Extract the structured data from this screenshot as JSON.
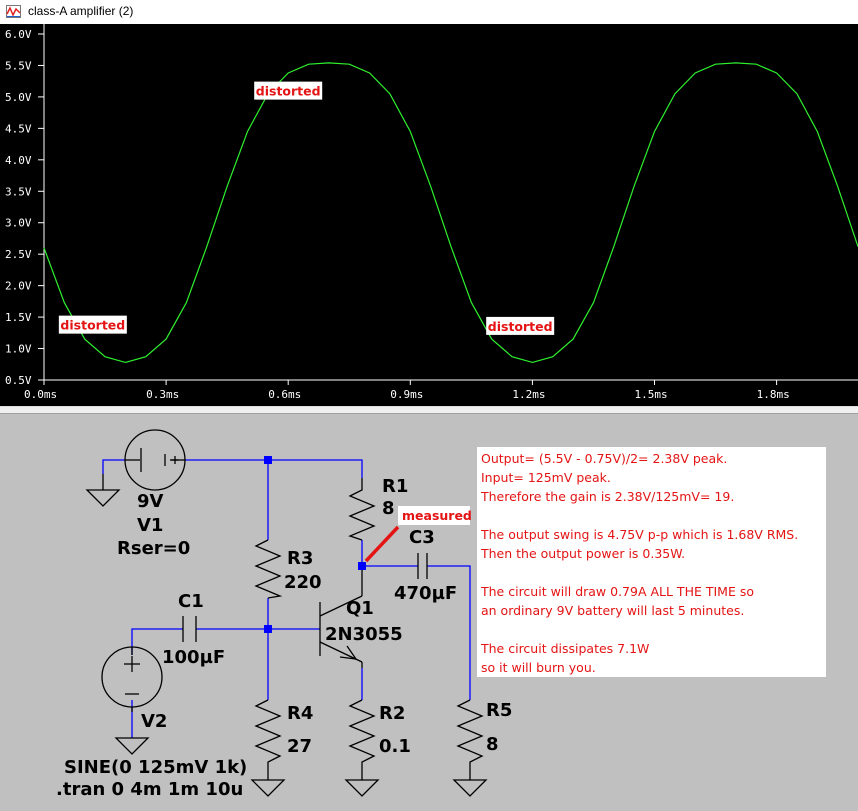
{
  "window": {
    "title": "class-A amplifier (2)",
    "icon": "waveform-icon"
  },
  "plot": {
    "background": "#000000",
    "trace_color": "#2ef02e",
    "y_ticks": [
      "6.0V",
      "5.5V",
      "5.0V",
      "4.5V",
      "4.0V",
      "3.5V",
      "3.0V",
      "2.5V",
      "2.0V",
      "1.5V",
      "1.0V",
      "0.5V"
    ],
    "x_ticks": [
      "0.0ms",
      "0.3ms",
      "0.6ms",
      "0.9ms",
      "1.2ms",
      "1.5ms",
      "1.8ms"
    ],
    "annotations": [
      "distorted",
      "distorted",
      "distorted"
    ]
  },
  "chart_data": {
    "type": "line",
    "title": "",
    "xlabel": "",
    "ylabel": "",
    "xlim": [
      0,
      2.0
    ],
    "ylim": [
      0.5,
      6.0
    ],
    "x_unit": "ms",
    "y_unit": "V",
    "grid": false,
    "series": [
      {
        "color": "#2ef02e",
        "x": [
          0.0,
          0.05,
          0.1,
          0.15,
          0.2,
          0.25,
          0.3,
          0.35,
          0.4,
          0.45,
          0.5,
          0.55,
          0.6,
          0.65,
          0.7,
          0.75,
          0.8,
          0.85,
          0.9,
          0.95,
          1.0,
          1.05,
          1.1,
          1.15,
          1.2,
          1.25,
          1.3,
          1.35,
          1.4,
          1.45,
          1.5,
          1.55,
          1.6,
          1.65,
          1.7,
          1.75,
          1.8,
          1.85,
          1.9,
          1.95,
          2.0
        ],
        "y": [
          2.6,
          1.73,
          1.15,
          0.87,
          0.78,
          0.87,
          1.15,
          1.73,
          2.62,
          3.58,
          4.45,
          5.05,
          5.38,
          5.52,
          5.54,
          5.52,
          5.38,
          5.05,
          4.45,
          3.58,
          2.62,
          1.73,
          1.15,
          0.87,
          0.78,
          0.87,
          1.15,
          1.73,
          2.62,
          3.58,
          4.45,
          5.05,
          5.38,
          5.52,
          5.54,
          5.52,
          5.38,
          5.05,
          4.45,
          3.58,
          2.62
        ]
      }
    ],
    "annotations": [
      {
        "text": "distorted",
        "x": 0.6,
        "y": 5.1
      },
      {
        "text": "distorted",
        "x": 0.12,
        "y": 1.38
      },
      {
        "text": "distorted",
        "x": 1.17,
        "y": 1.36
      }
    ]
  },
  "schematic": {
    "labels": {
      "v1_value": "9V",
      "v1_name": "V1",
      "v1_rser": "Rser=0",
      "r1_name": "R1",
      "r1_value": "8",
      "measured": "measured",
      "c3_name": "C3",
      "c3_value": "470µF",
      "r3_name": "R3",
      "r3_value": "220",
      "c1_name": "C1",
      "c1_value": "100µF",
      "q1_name": "Q1",
      "q1_model": "2N3055",
      "v2_name": "V2",
      "v2_source": "SINE(0 125mV 1k)",
      "tran": ".tran 0 4m 1m 10u",
      "r4_name": "R4",
      "r4_value": "27",
      "r2_name": "R2",
      "r2_value": "0.1",
      "r5_name": "R5",
      "r5_value": "8"
    },
    "wire_color": "#0000ff",
    "component_color": "#000000",
    "junction_color": "#0000ff",
    "marker_color": "#e41414"
  },
  "notes": {
    "lines": [
      "Output= (5.5V - 0.75V)/2= 2.38V peak.",
      "Input= 125mV peak.",
      "Therefore the gain is 2.38V/125mV= 19.",
      "",
      "The output swing is 4.75V p-p which is 1.68V RMS.",
      "Then the output power is 0.35W.",
      "",
      "The circuit will draw 0.79A ALL THE TIME so",
      "an ordinary 9V battery will last 5 minutes.",
      "",
      "The circuit dissipates 7.1W",
      "so it will burn you."
    ]
  }
}
